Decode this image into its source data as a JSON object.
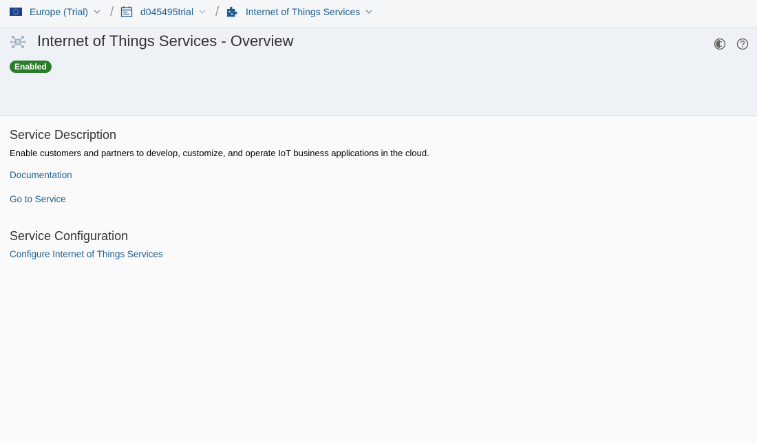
{
  "breadcrumb": {
    "region": {
      "label": "Europe (Trial)",
      "icon": "eu-flag-icon"
    },
    "account": {
      "label": "d045495trial",
      "icon": "subaccount-icon"
    },
    "service": {
      "label": "Internet of Things Services",
      "icon": "puzzle-icon"
    }
  },
  "header": {
    "title": "Internet of Things Services - Overview",
    "status": "Enabled",
    "status_color": "#2b7d2b",
    "actions": [
      "theme-toggle-icon",
      "help-icon"
    ]
  },
  "service_description": {
    "heading": "Service Description",
    "text": "Enable customers and partners to develop, customize, and operate IoT business applications in the cloud.",
    "links": {
      "documentation": "Documentation",
      "go_to_service": "Go to Service"
    }
  },
  "service_configuration": {
    "heading": "Service Configuration",
    "link": "Configure Internet of Things Services"
  },
  "colors": {
    "link": "#1f5f8e",
    "header_bg": "#eef2f6",
    "page_bg": "#fafafa"
  }
}
